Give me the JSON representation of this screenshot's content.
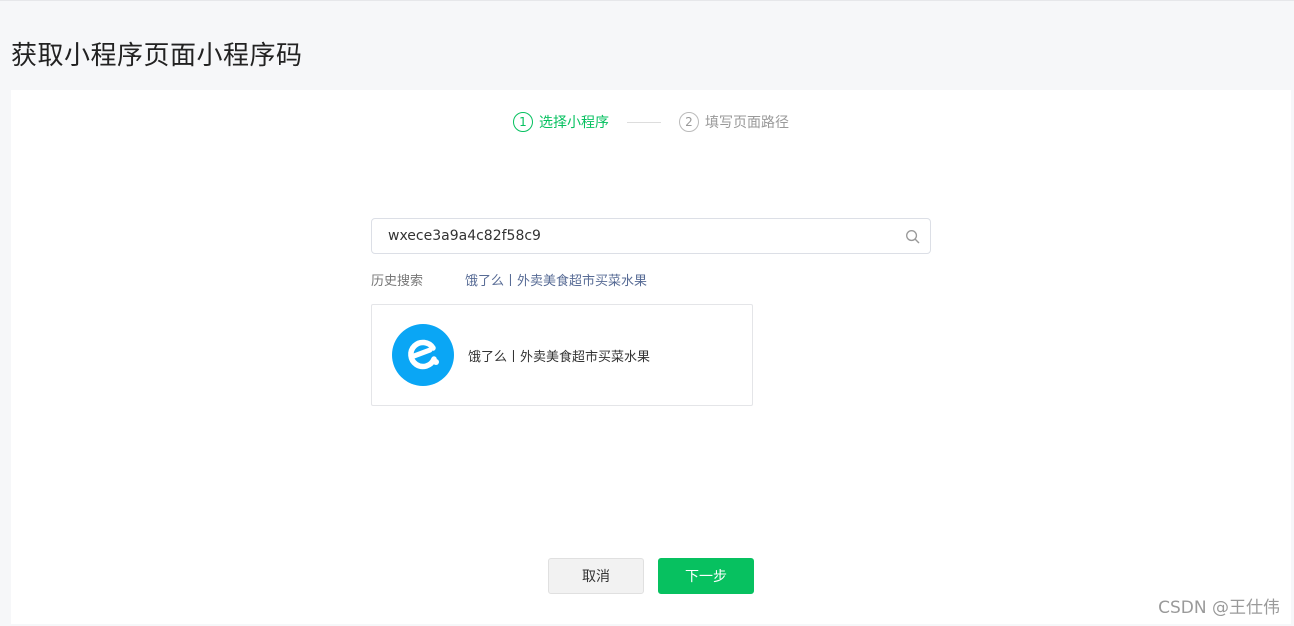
{
  "page": {
    "title": "获取小程序页面小程序码"
  },
  "steps": [
    {
      "num": "1",
      "label": "选择小程序",
      "active": true
    },
    {
      "num": "2",
      "label": "填写页面路径",
      "active": false
    }
  ],
  "search": {
    "value": "wxece3a9a4c82f58c9",
    "icon": "search-icon"
  },
  "history": {
    "label": "历史搜索",
    "items": [
      "饿了么丨外卖美食超市买菜水果"
    ]
  },
  "result": {
    "name": "饿了么丨外卖美食超市买菜水果",
    "logo_color": "#0aa6f5"
  },
  "buttons": {
    "cancel": "取消",
    "next": "下一步"
  },
  "colors": {
    "accent": "#07c160",
    "link": "#576b95"
  },
  "watermark": "CSDN @王仕伟"
}
